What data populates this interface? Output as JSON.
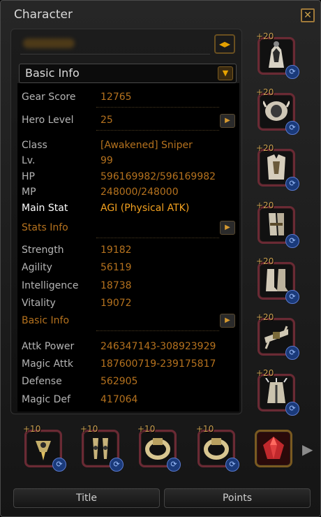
{
  "window": {
    "title": "Character",
    "close_icon": "close-icon"
  },
  "dropdown": {
    "selected": "Basic Info"
  },
  "stats": {
    "gear_score": {
      "label": "Gear Score",
      "value": "12765"
    },
    "hero_level": {
      "label": "Hero Level",
      "value": "25"
    },
    "class": {
      "label": "Class",
      "value": "[Awakened] Sniper"
    },
    "level": {
      "label": "Lv.",
      "value": "99"
    },
    "hp": {
      "label": "HP",
      "value": "596169982/596169982"
    },
    "mp": {
      "label": "MP",
      "value": "248000/248000"
    },
    "main_stat": {
      "label": "Main Stat",
      "value": "AGI (Physical ATK)"
    },
    "stats_info_title": "Stats Info",
    "strength": {
      "label": "Strength",
      "value": "19182"
    },
    "agility": {
      "label": "Agility",
      "value": "56119"
    },
    "intelligence": {
      "label": "Intelligence",
      "value": "18738"
    },
    "vitality": {
      "label": "Vitality",
      "value": "19072"
    },
    "basic_info_title": "Basic Info",
    "attk_power": {
      "label": "Attk Power",
      "value": "246347143-308923929"
    },
    "magic_attk": {
      "label": "Magic Attk",
      "value": "187600719-239175817"
    },
    "defense": {
      "label": "Defense",
      "value": "562905"
    },
    "magic_def": {
      "label": "Magic Def",
      "value": "417064"
    }
  },
  "equipment_right": [
    {
      "plus": "+20",
      "icon": "helmet-icon"
    },
    {
      "plus": "+20",
      "icon": "shoulder-armor-icon"
    },
    {
      "plus": "+20",
      "icon": "chest-armor-icon"
    },
    {
      "plus": "+20",
      "icon": "gloves-icon"
    },
    {
      "plus": "+20",
      "icon": "boots-icon"
    },
    {
      "plus": "+20",
      "icon": "belt-icon"
    },
    {
      "plus": "+20",
      "icon": "leg-armor-icon"
    }
  ],
  "equipment_bottom": [
    {
      "plus": "+10",
      "icon": "necklace-icon"
    },
    {
      "plus": "+10",
      "icon": "earring-icon"
    },
    {
      "plus": "+10",
      "icon": "ring-icon"
    },
    {
      "plus": "+10",
      "icon": "ring-icon"
    },
    {
      "plus": "",
      "icon": "red-gem-icon"
    }
  ],
  "buttons": {
    "title": "Title",
    "points": "Points"
  },
  "colors": {
    "value": "#b5721e",
    "main_stat": "#f4a21f",
    "frame": "#6a2a34",
    "refresh": "#1a3a7a"
  }
}
